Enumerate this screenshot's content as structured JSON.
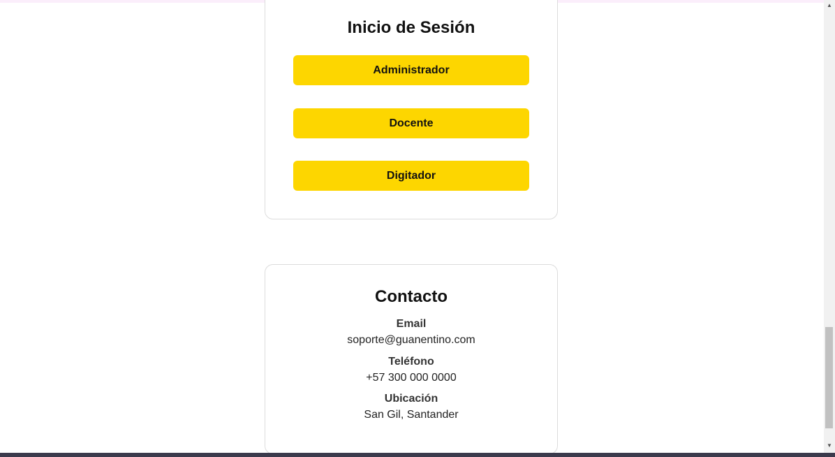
{
  "login": {
    "title": "Inicio de Sesión",
    "buttons": [
      {
        "label": "Administrador"
      },
      {
        "label": "Docente"
      },
      {
        "label": "Digitador"
      }
    ]
  },
  "contact": {
    "title": "Contacto",
    "email": {
      "label": "Email",
      "value": "soporte@guanentino.com"
    },
    "phone": {
      "label": "Teléfono",
      "value": "+57 300 000 0000"
    },
    "location": {
      "label": "Ubicación",
      "value": "San Gil, Santander"
    }
  },
  "colors": {
    "button_accent": "#fdd600",
    "card_border": "#dcdcdc"
  },
  "icons": {
    "scroll_up": "scroll-up-arrow-icon",
    "scroll_down": "scroll-down-arrow-icon"
  }
}
